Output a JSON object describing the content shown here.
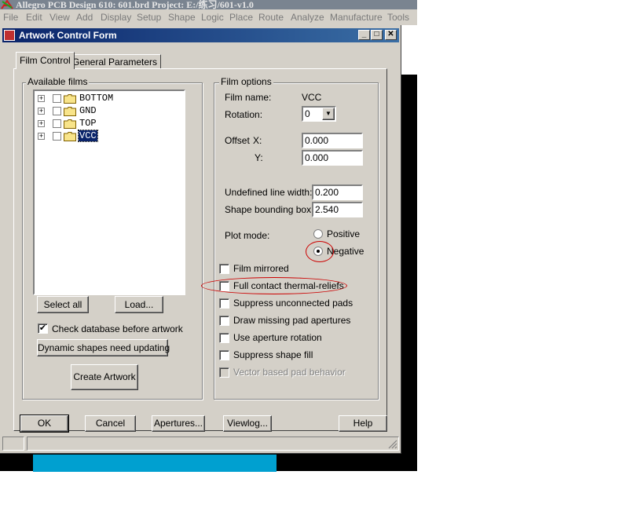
{
  "app": {
    "title": "Allegro PCB Design 610: 601.brd  Project: E:/练习/601-v1.0"
  },
  "menu": [
    "File",
    "Edit",
    "View",
    "Add",
    "Display",
    "Setup",
    "Shape",
    "Logic",
    "Place",
    "Route",
    "Analyze",
    "Manufacture",
    "Tools"
  ],
  "dialog": {
    "title": "Artwork Control Form",
    "tabs": [
      "Film Control",
      "General Parameters"
    ],
    "active_tab": "Film Control"
  },
  "available_films": {
    "label": "Available films",
    "items": [
      {
        "name": "BOTTOM",
        "selected": false
      },
      {
        "name": "GND",
        "selected": false
      },
      {
        "name": "TOP",
        "selected": false
      },
      {
        "name": "VCC",
        "selected": true
      }
    ],
    "select_all": "Select all",
    "load": "Load...",
    "check_database": {
      "label": "Check database before artwork",
      "checked": true
    },
    "dynamic_shapes": "Dynamic shapes need updating",
    "create_artwork": "Create Artwork"
  },
  "film_options": {
    "label": "Film options",
    "film_name_label": "Film name:",
    "film_name": "VCC",
    "rotation_label": "Rotation:",
    "rotation": "0",
    "offset_label": "Offset",
    "offset_x_label": "X:",
    "offset_x": "0.000",
    "offset_y_label": "Y:",
    "offset_y": "0.000",
    "undefined_line_width_label": "Undefined line width:",
    "undefined_line_width": "0.200",
    "shape_bounding_box_label": "Shape bounding box:",
    "shape_bounding_box": "2.540",
    "plot_mode_label": "Plot mode:",
    "plot_mode_positive": "Positive",
    "plot_mode_negative": "Negative",
    "plot_mode": "Negative",
    "checkboxes": [
      {
        "label": "Film mirrored",
        "checked": false,
        "enabled": true
      },
      {
        "label": "Full contact thermal-reliefs",
        "checked": false,
        "enabled": true
      },
      {
        "label": "Suppress unconnected pads",
        "checked": false,
        "enabled": true
      },
      {
        "label": "Draw missing pad apertures",
        "checked": false,
        "enabled": true
      },
      {
        "label": "Use aperture rotation",
        "checked": false,
        "enabled": true
      },
      {
        "label": "Suppress shape fill",
        "checked": false,
        "enabled": true
      },
      {
        "label": "Vector based pad behavior",
        "checked": false,
        "enabled": false
      }
    ]
  },
  "footer_buttons": {
    "ok": "OK",
    "cancel": "Cancel",
    "apertures": "Apertures...",
    "viewlog": "Viewlog...",
    "help": "Help"
  },
  "colors": {
    "titlebar_start": "#0a246a",
    "titlebar_end": "#3a6ea5",
    "dialog_bg": "#d4d0c8",
    "annotation": "#cc0000",
    "canvas_cyan": "#00a0d0"
  },
  "icons": [
    "allegro-logo-icon",
    "dialog-icon",
    "minimize-icon",
    "maximize-icon",
    "close-icon",
    "folder-icon",
    "dropdown-arrow-icon",
    "resize-grip-icon"
  ]
}
